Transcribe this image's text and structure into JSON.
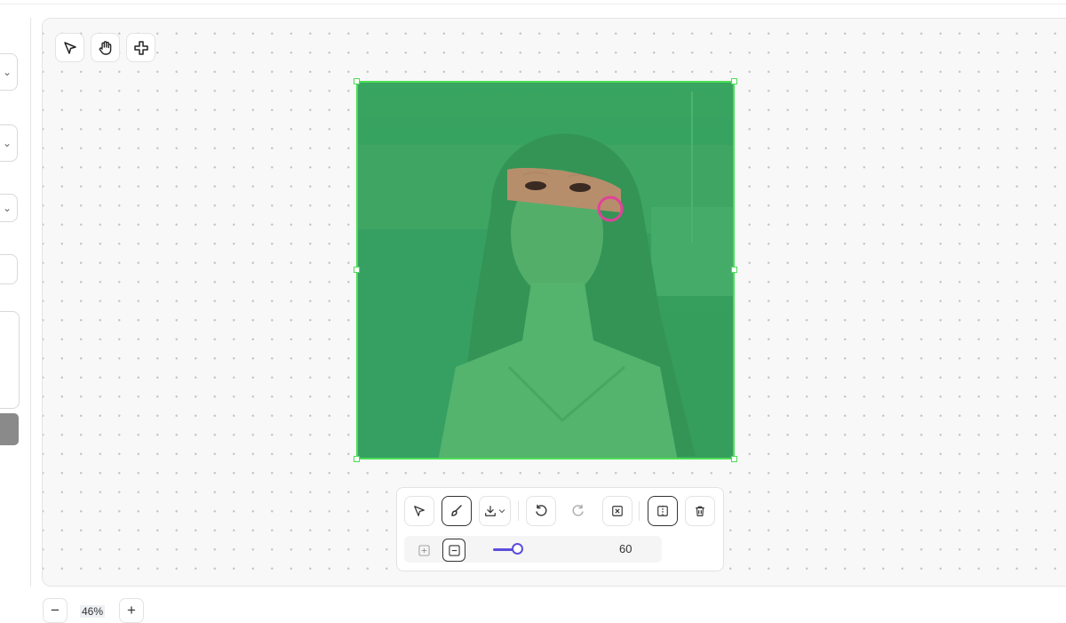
{
  "canvas_tools": {
    "select": "select-arrow-icon",
    "pan": "hand-icon",
    "move": "move-cross-icon"
  },
  "image": {
    "mask_color": "#40c86e",
    "frame_color": "#4ade55",
    "cursor_color": "#e0429a"
  },
  "toolbar": {
    "brush_size": "60",
    "slider_fraction": 0.18,
    "accent": "#5b4fd9"
  },
  "zoom": {
    "value": "46%",
    "minus": "−",
    "plus": "+"
  }
}
